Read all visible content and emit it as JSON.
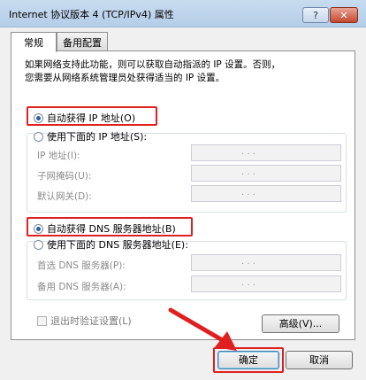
{
  "window": {
    "title": "Internet 协议版本 4 (TCP/IPv4) 属性",
    "help_label": "?",
    "close_label": "✕"
  },
  "tabs": [
    {
      "label": "常规",
      "active": true
    },
    {
      "label": "备用配置",
      "active": false
    }
  ],
  "description": {
    "line1": "如果网络支持此功能，则可以获取自动指派的 IP 设置。否则，",
    "line2": "您需要从网络系统管理员处获得适当的 IP 设置。"
  },
  "ip_section": {
    "auto_label": "自动获得 IP 地址(O)",
    "auto_selected": true,
    "manual_label": "使用下面的 IP 地址(S):",
    "fields": [
      {
        "label": "IP 地址(I):",
        "value": ". . ."
      },
      {
        "label": "子网掩码(U):",
        "value": ". . ."
      },
      {
        "label": "默认网关(D):",
        "value": ". . ."
      }
    ]
  },
  "dns_section": {
    "auto_label": "自动获得 DNS 服务器地址(B)",
    "auto_selected": true,
    "manual_label": "使用下面的 DNS 服务器地址(E):",
    "fields": [
      {
        "label": "首选 DNS 服务器(P):",
        "value": ". . ."
      },
      {
        "label": "备用 DNS 服务器(A):",
        "value": ". . ."
      }
    ]
  },
  "validate_checkbox": {
    "label": "退出时验证设置(L)",
    "checked": false
  },
  "advanced_button": "高级(V)...",
  "ok_button": "确定",
  "cancel_button": "取消",
  "colors": {
    "highlight": "#e02020",
    "accent": "#2a5fa8"
  }
}
